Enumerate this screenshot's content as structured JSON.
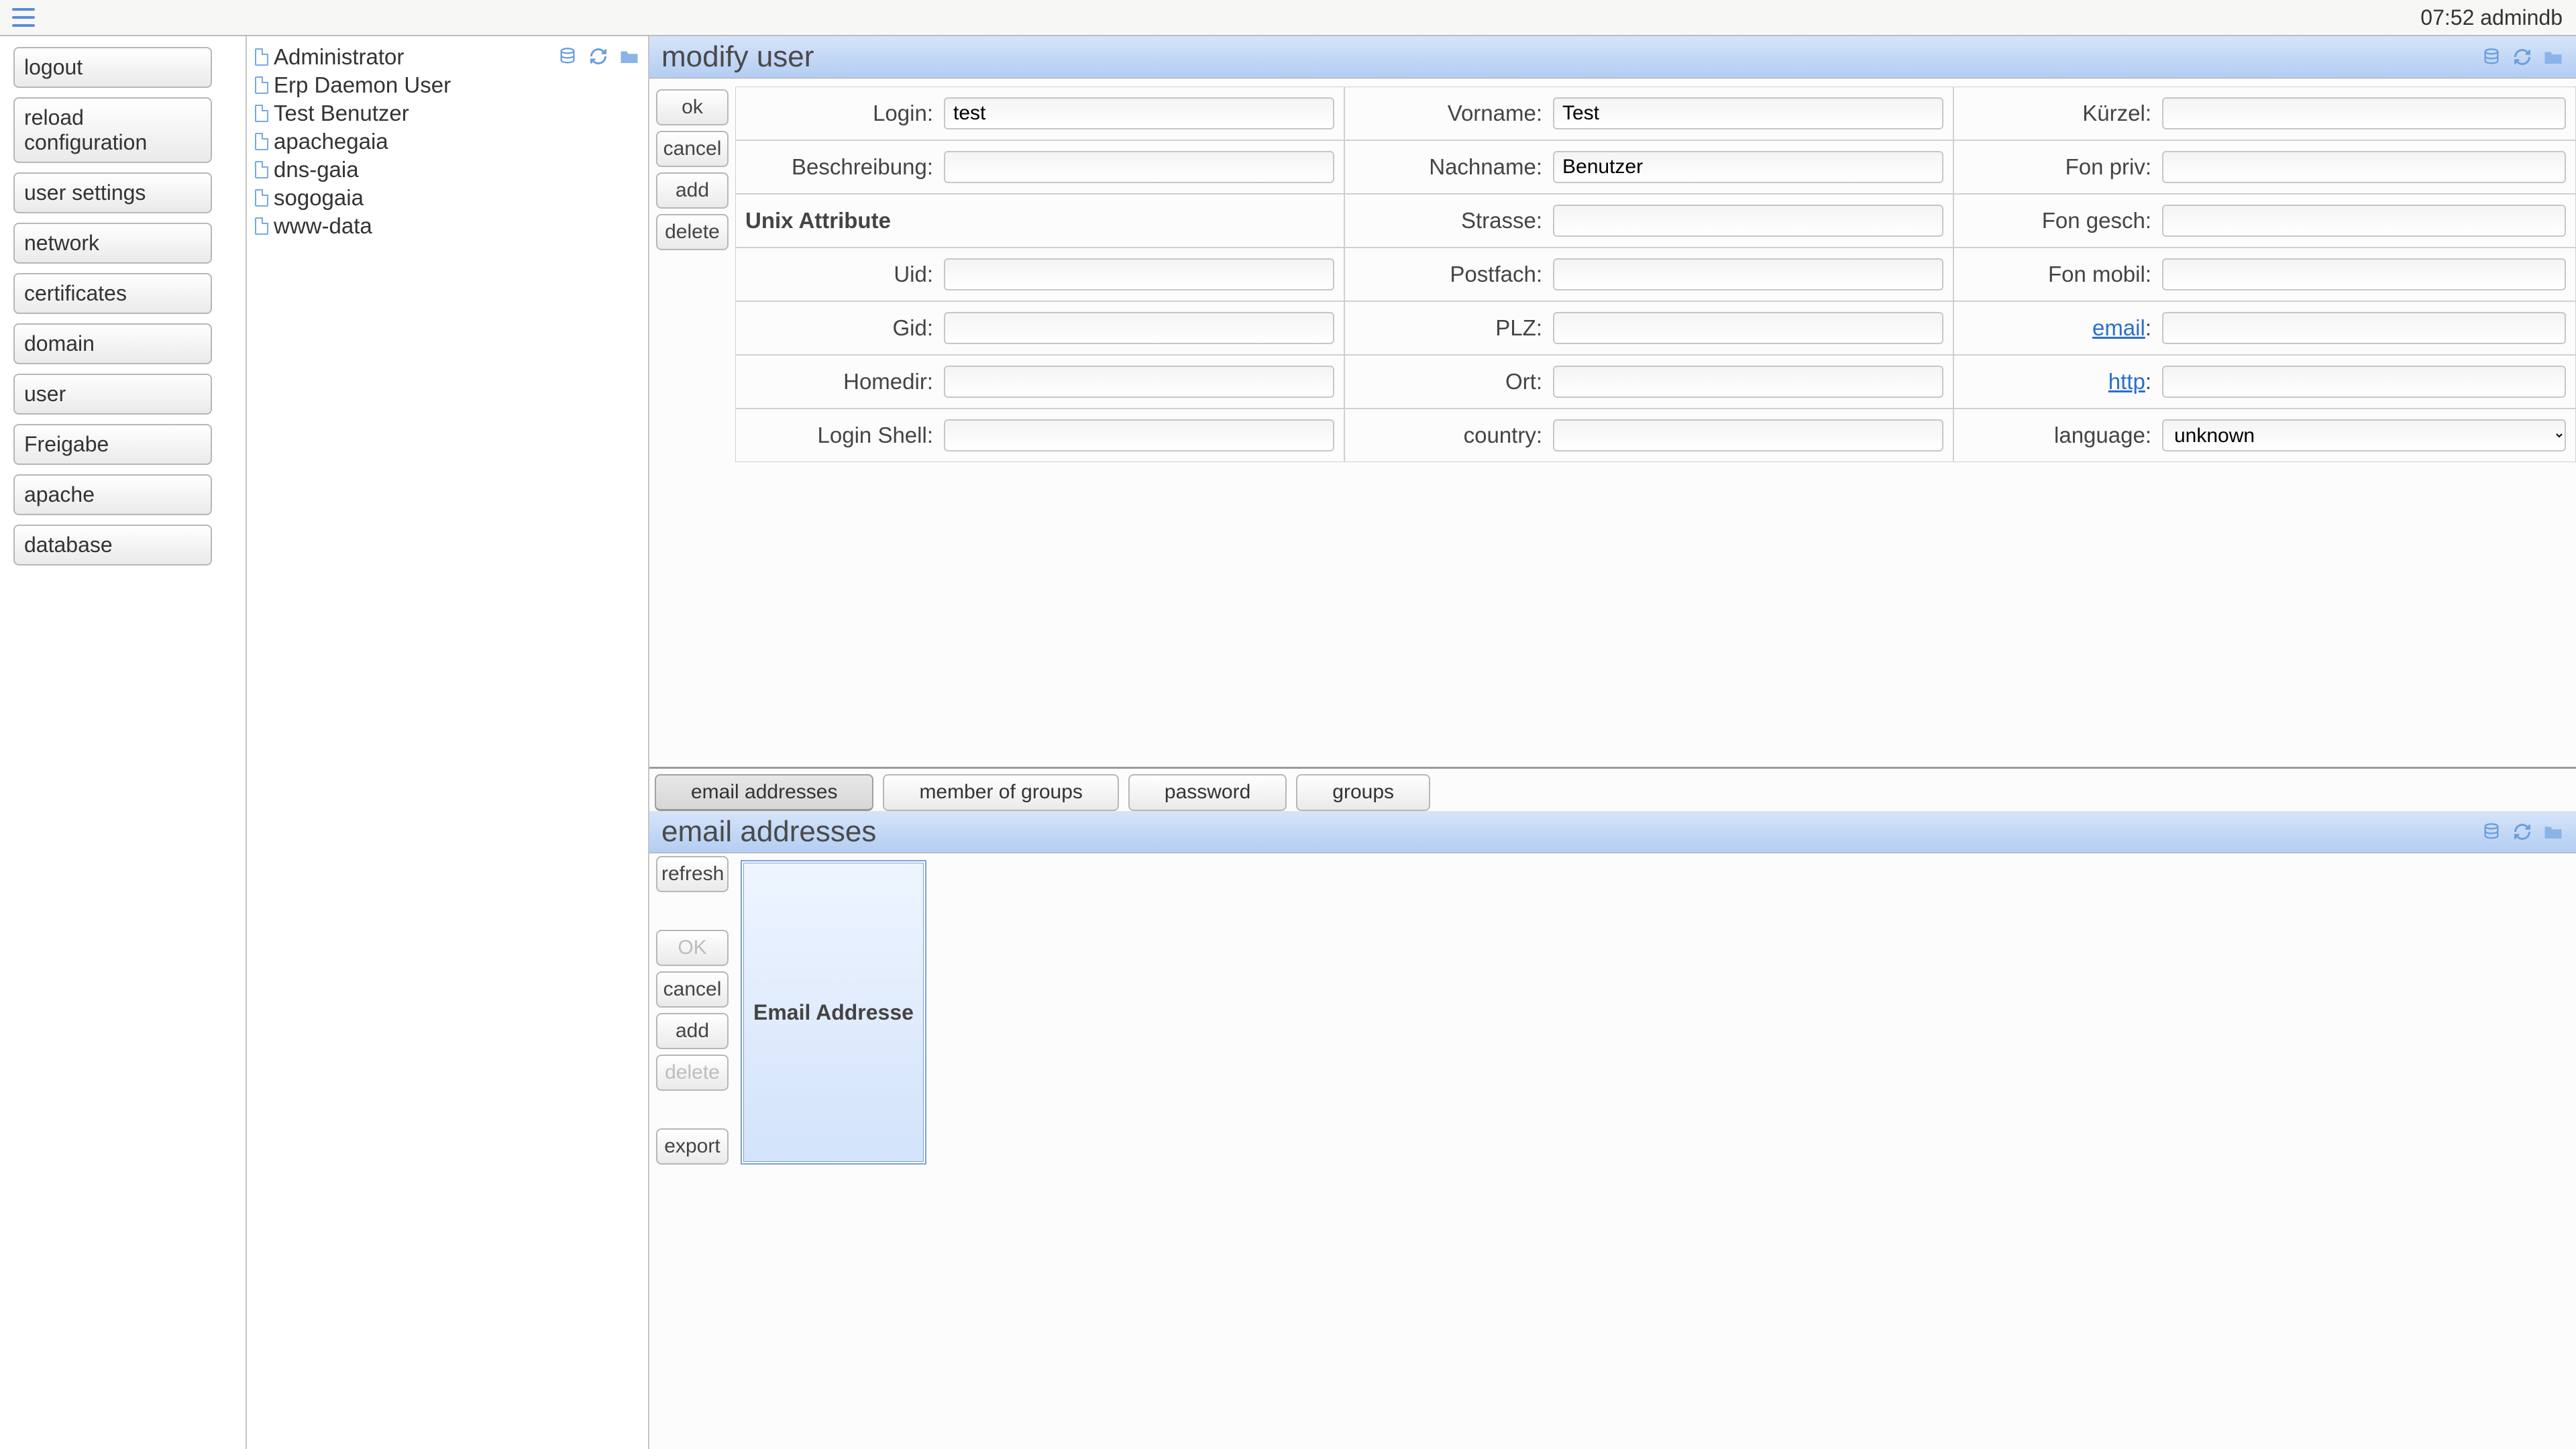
{
  "top": {
    "time": "07:52",
    "user": "admindb"
  },
  "sidebar": {
    "items": [
      {
        "label": "logout"
      },
      {
        "label": "reload configuration"
      },
      {
        "label": "user settings"
      },
      {
        "label": "network"
      },
      {
        "label": "certificates"
      },
      {
        "label": "domain"
      },
      {
        "label": "user"
      },
      {
        "label": "Freigabe"
      },
      {
        "label": "apache"
      },
      {
        "label": "database"
      }
    ]
  },
  "userlist": {
    "items": [
      {
        "label": "Administrator"
      },
      {
        "label": "Erp Daemon User"
      },
      {
        "label": "Test Benutzer"
      },
      {
        "label": "apachegaia"
      },
      {
        "label": "dns-gaia"
      },
      {
        "label": "sogogaia"
      },
      {
        "label": "www-data"
      }
    ]
  },
  "modify": {
    "title": "modify user",
    "actions": {
      "ok": "ok",
      "cancel": "cancel",
      "add": "add",
      "delete": "delete"
    },
    "fields": {
      "login": {
        "label": "Login:",
        "value": "test"
      },
      "vorname": {
        "label": "Vorname:",
        "value": "Test"
      },
      "kuerzel": {
        "label": "Kürzel:",
        "value": ""
      },
      "beschreibung": {
        "label": "Beschreibung:",
        "value": ""
      },
      "nachname": {
        "label": "Nachname:",
        "value": "Benutzer"
      },
      "fonpriv": {
        "label": "Fon priv:",
        "value": ""
      },
      "unix_section": {
        "label": "Unix Attribute"
      },
      "strasse": {
        "label": "Strasse:",
        "value": ""
      },
      "fongesch": {
        "label": "Fon gesch:",
        "value": ""
      },
      "uid": {
        "label": "Uid:",
        "value": ""
      },
      "postfach": {
        "label": "Postfach:",
        "value": ""
      },
      "fonmobil": {
        "label": "Fon mobil:",
        "value": ""
      },
      "gid": {
        "label": "Gid:",
        "value": ""
      },
      "plz": {
        "label": "PLZ:",
        "value": ""
      },
      "email": {
        "label": "email",
        "value": ""
      },
      "homedir": {
        "label": "Homedir:",
        "value": ""
      },
      "ort": {
        "label": "Ort:",
        "value": ""
      },
      "http": {
        "label": "http",
        "value": ""
      },
      "loginshell": {
        "label": "Login Shell:",
        "value": ""
      },
      "country": {
        "label": "country:",
        "value": ""
      },
      "language": {
        "label": "language:",
        "value": "unknown"
      }
    }
  },
  "tabs": [
    {
      "label": "email addresses",
      "active": true
    },
    {
      "label": "member of groups",
      "active": false
    },
    {
      "label": "password",
      "active": false
    },
    {
      "label": "groups",
      "active": false
    }
  ],
  "emails": {
    "title": "email addresses",
    "actions": {
      "refresh": "refresh",
      "ok": "OK",
      "cancel": "cancel",
      "add": "add",
      "delete": "delete",
      "export": "export"
    },
    "table": {
      "header": "Email Addresse"
    }
  }
}
